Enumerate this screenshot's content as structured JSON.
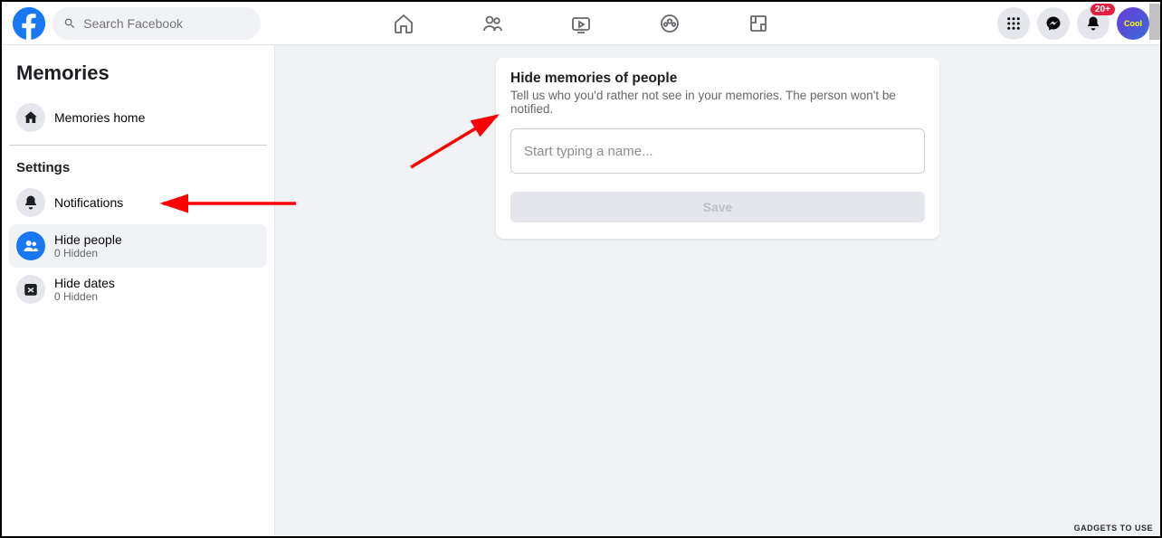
{
  "header": {
    "search_placeholder": "Search Facebook",
    "notification_badge": "20+"
  },
  "sidebar": {
    "title": "Memories",
    "home_label": "Memories home",
    "settings_label": "Settings",
    "items": {
      "notifications": {
        "label": "Notifications"
      },
      "hide_people": {
        "label": "Hide people",
        "sub": "0 Hidden"
      },
      "hide_dates": {
        "label": "Hide dates",
        "sub": "0 Hidden"
      }
    }
  },
  "card": {
    "title": "Hide memories of people",
    "desc": "Tell us who you'd rather not see in your memories. The person won't be notified.",
    "input_placeholder": "Start typing a name...",
    "save_label": "Save"
  },
  "watermark": "GADGETS TO USE"
}
